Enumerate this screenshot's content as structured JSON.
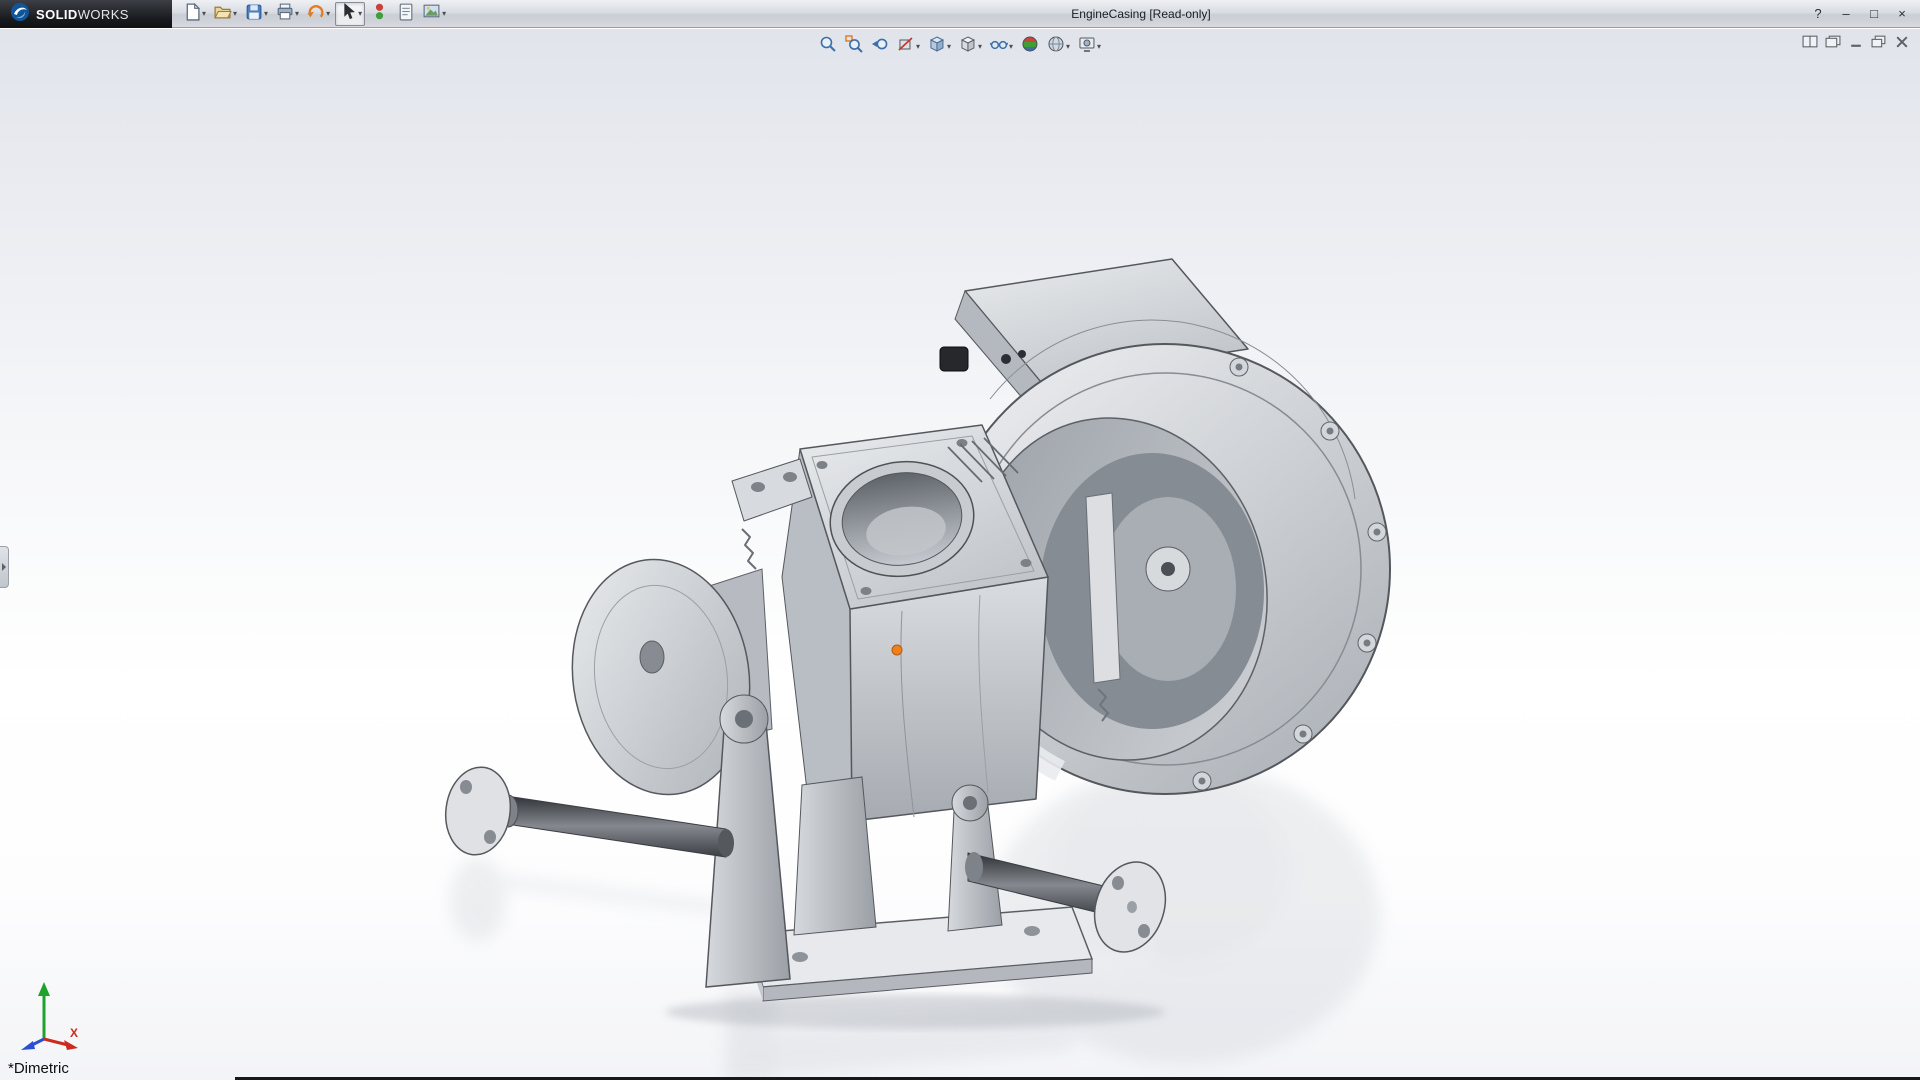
{
  "titlebar": {
    "brand": {
      "logo_icon": "dassault-3ds-logo-icon",
      "bold": "SOLID",
      "light": "WORKS"
    },
    "title": "EngineCasing [Read-only]",
    "caret_glyph": "▾",
    "toolbar_icons": [
      "new-document",
      "open",
      "save",
      "print",
      "undo",
      "select",
      "rebuild",
      "file-properties",
      "options"
    ],
    "window_controls": {
      "help": "?",
      "minimize": "–",
      "restore": "□",
      "close": "×"
    }
  },
  "headsup_toolbar": {
    "icons": [
      "zoom-to-fit",
      "zoom-to-area",
      "previous-view",
      "section-view",
      "view-orientation",
      "display-style",
      "hide-show-items",
      "edit-appearance",
      "apply-scene",
      "view-settings"
    ]
  },
  "document_window_controls": [
    "tile-vertical",
    "cascade",
    "minimize",
    "restore",
    "close"
  ],
  "viewport": {
    "view_label": "*Dimetric",
    "selection_marker_color": "#f08019",
    "gradient_top": "#e1e4eb",
    "gradient_bottom": "#f3f4f7"
  },
  "triad": {
    "x_label": "X",
    "axis_colors": {
      "x": "#cc2a1e",
      "y": "#1fa12c",
      "z": "#2a4fd0"
    }
  }
}
